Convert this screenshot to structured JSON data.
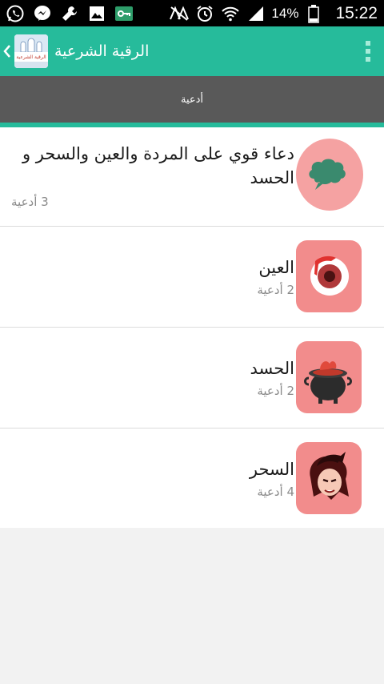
{
  "status_bar": {
    "battery_percent": "14%",
    "time": "15:22"
  },
  "app_bar": {
    "title": "الرقية الشرعية",
    "logo_caption": "الرقية الشرعية"
  },
  "tabs": [
    {
      "label": "أدعية",
      "selected": true
    }
  ],
  "items": [
    {
      "title": "دعاء قوي على المردة والعين والسحر و الحسد",
      "count": "3 أدعية",
      "icon": "chat-bubble-icon"
    },
    {
      "title": "العين",
      "count": "2 أدعية",
      "icon": "evil-eye-icon"
    },
    {
      "title": "الحسد",
      "count": "2 أدعية",
      "icon": "cauldron-icon"
    },
    {
      "title": "السحر",
      "count": "4 أدعية",
      "icon": "witch-icon"
    }
  ],
  "colors": {
    "app_bar": "#26bb9b",
    "tab_bar": "#595959",
    "thumb": "#f28c8c"
  }
}
